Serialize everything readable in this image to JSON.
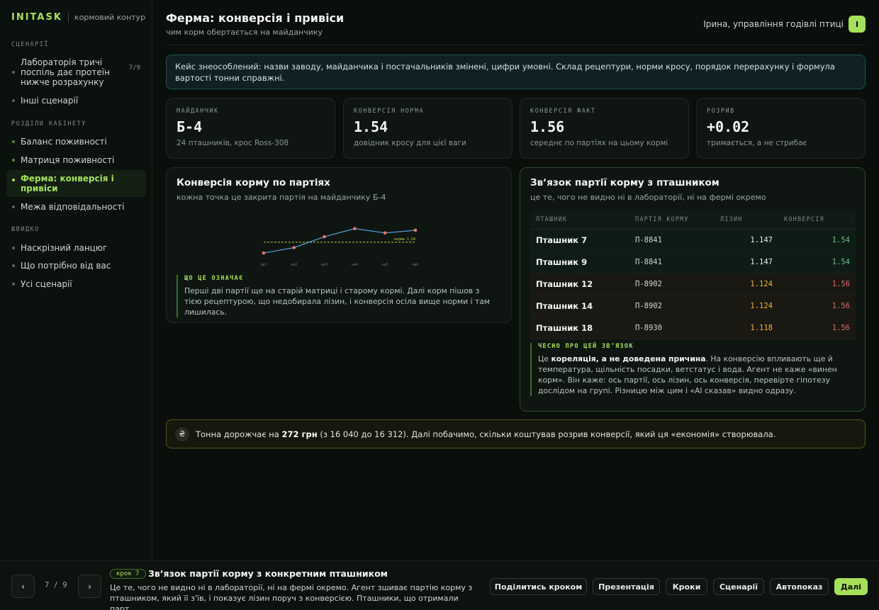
{
  "sidebar": {
    "brand": "INITASK",
    "brand_sub": "кормовий контур",
    "section_scenarios": "СЦЕНАРІЇ",
    "scenario_item": "Лабораторія тричі поспіль дає протеїн нижче розрахунку",
    "scenario_count": "7/9",
    "other_scenarios": "Інші сценарії",
    "section_cabinet": "РОЗДІЛИ КАБІНЕТУ",
    "cabinet_items": [
      "Баланс поживності",
      "Матриця поживності",
      "Ферма: конверсія і привіси",
      "Межа відповідальності"
    ],
    "section_quick": "ШВИДКО",
    "quick_items": [
      "Наскрізний ланцюг",
      "Що потрібно від вас",
      "Усі сценарії"
    ]
  },
  "header": {
    "title": "Ферма: конверсія і привіси",
    "subtitle": "чим корм обертається на майданчику",
    "user": "Ірина, управління годівлі птиці",
    "avatar": "І"
  },
  "notice": "Кейс знеособлений: назви заводу, майданчика і постачальників змінені, цифри умовні. Склад рецептури, норми кросу, порядок перерахунку і формула вартості тонни справжні.",
  "kpis": [
    {
      "label": "МАЙДАНЧИК",
      "value": "Б-4",
      "note": "24 пташників, крос Ross-308"
    },
    {
      "label": "КОНВЕРСІЯ НОРМА",
      "value": "1.54",
      "note": "довідник кросу для цієї ваги"
    },
    {
      "label": "КОНВЕРСІЯ ФАКТ",
      "value": "1.56",
      "note": "середнє по партіях на цьому кормі"
    },
    {
      "label": "РОЗРИВ",
      "value": "+0.02",
      "note": "тримається, а не стрибає"
    }
  ],
  "chart_card": {
    "title": "Конверсія корму по партіях",
    "subtitle": "кожна точка це закрита партія на майданчику Б-4",
    "callout_label": "ЩО ЦЕ ОЗНАЧАЄ",
    "callout_text": "Перші дві партії ще на старій матриці і старому кормі. Далі корм пішов з тією рецептурою, що недобирала лізин, і конверсія осіла вище норми і там лишилась."
  },
  "chart_data": {
    "type": "line",
    "categories": [
      "кв1",
      "кв2",
      "кв3",
      "кв4",
      "кв5",
      "кв6"
    ],
    "series": [
      {
        "values": [
          1.52,
          1.53,
          1.55,
          1.565,
          1.557,
          1.562
        ]
      }
    ],
    "reference_line": {
      "label": "норма 1.54",
      "value": 1.54
    },
    "ylim": [
      1.515,
      1.575
    ],
    "colors": {
      "line": "#5aa0d8",
      "points": "#e07a6a",
      "reference": "#b8d043"
    }
  },
  "link_card": {
    "title": "Звʼязок партії корму з пташником",
    "subtitle": "це те, чого не видно ні в лабораторії, ні на фермі окремо",
    "columns": [
      "ПТАШНИК",
      "ПАРТІЯ КОРМУ",
      "ЛІЗИН",
      "КОНВЕРСІЯ"
    ],
    "rows": [
      {
        "bird": "Пташник 7",
        "batch": "П-8841",
        "lysine": "1.147",
        "conv": "1.54",
        "status": "ok"
      },
      {
        "bird": "Пташник 9",
        "batch": "П-8841",
        "lysine": "1.147",
        "conv": "1.54",
        "status": "ok"
      },
      {
        "bird": "Пташник 12",
        "batch": "П-8902",
        "lysine": "1.124",
        "conv": "1.56",
        "status": "bad"
      },
      {
        "bird": "Пташник 14",
        "batch": "П-8902",
        "lysine": "1.124",
        "conv": "1.56",
        "status": "bad"
      },
      {
        "bird": "Пташник 18",
        "batch": "П-8930",
        "lysine": "1.118",
        "conv": "1.56",
        "status": "bad"
      }
    ],
    "callout_label": "ЧЕСНО ПРО ЦЕЙ ЗВʼЯЗОК",
    "callout_pre": "Це ",
    "callout_bold": "кореляція, а не доведена причина",
    "callout_post": ". На конверсію впливають ще й температура, щільність посадки, ветстатус і вода. Агент не каже «винен корм». Він каже: ось партії, ось лізин, ось конверсія, перевірте гіпотезу дослідом на групі. Різницю між цим і «AI сказав» видно одразу."
  },
  "summary": {
    "icon": "₴",
    "pre": "Тонна дорожчає на ",
    "bold": "272 грн",
    "post": " (з 16 040 до 16 312). Далі побачимо, скільки коштував розрив конверсії, який ця «економія» створювала."
  },
  "footer": {
    "prev": "‹",
    "next": "›",
    "pager": "7 / 9",
    "step_badge": "крок 7",
    "step_title": "Звʼязок партії корму з конкретним пташником",
    "step_desc": "Це те, чого не видно ні в лабораторії, ні на фермі окремо. Агент зшиває партію корму з пташником, який її з'їв, і показує лізин поруч з конверсією. Пташники, що отримали парт...",
    "buttons": [
      "Поділитись кроком",
      "Презентація",
      "Кроки",
      "Сценарії",
      "Автопоказ",
      "Далі"
    ]
  },
  "colors": {
    "accent": "#a6e05a",
    "ok": "#5ec38a",
    "warn": "#e8b43a",
    "bad": "#e06a6a"
  }
}
